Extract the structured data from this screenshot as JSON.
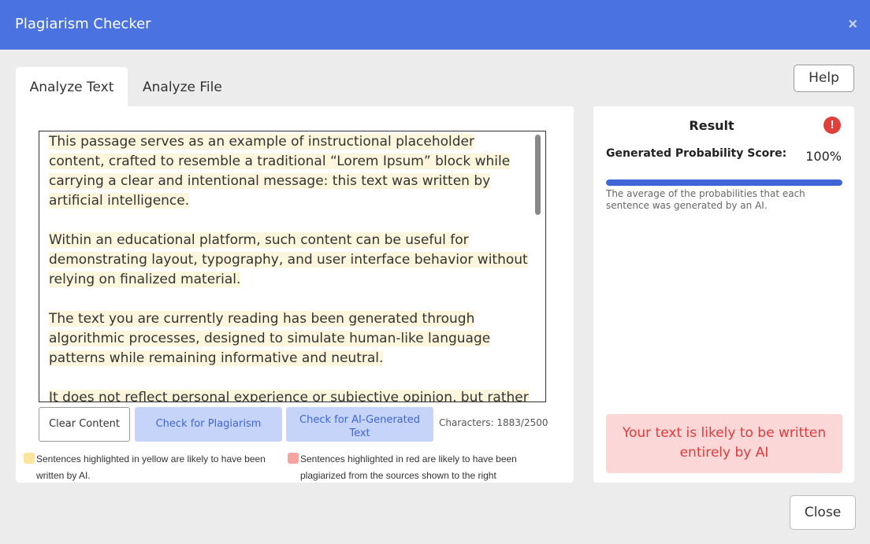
{
  "window": {
    "title": "Plagiarism Checker",
    "close_icon": "×"
  },
  "tabs": [
    {
      "label": "Analyze Text",
      "active": true
    },
    {
      "label": "Analyze File",
      "active": false
    }
  ],
  "help_label": "Help",
  "editor": {
    "paragraphs": [
      "This passage serves as an example of instructional placeholder content, crafted to resemble a traditional “Lorem Ipsum” block while carrying a clear and intentional message: this text was written by artificial intelligence.",
      "Within an educational platform, such content can be useful for demonstrating layout, typography, and user interface behavior without relying on finalized material.",
      "The text you are currently reading has been generated through algorithmic processes, designed to simulate human-like language patterns while remaining informative and neutral.",
      "It does not reflect personal experience or subjective opinion, but rather a"
    ],
    "highlight_color": "#fdf6dc"
  },
  "actions": {
    "clear_label": "Clear Content",
    "plagiarism_label": "Check for Plagiarism",
    "ai_label": "Check for AI-Generated Text",
    "char_count": "Characters: 1883/2500"
  },
  "legend": {
    "yellow_text": "Sentences highlighted in yellow are likely to have been written by AI.",
    "yellow_color": "#fbe49b",
    "red_text": "Sentences highlighted in red are likely to have been plagiarized from the sources shown to the right",
    "red_color": "#f5a5a0"
  },
  "result": {
    "title": "Result",
    "alert_icon": "!",
    "score_label": "Generated Probability Score:",
    "score_value": "100%",
    "score_fraction": 1.0,
    "description": "The average of the probabilities that each sentence was generated by an AI.",
    "verdict": "Your text is likely to be written entirely by AI",
    "accent_color": "#3e66d6",
    "verdict_color": "#e2393a"
  },
  "footer": {
    "close_label": "Close"
  }
}
